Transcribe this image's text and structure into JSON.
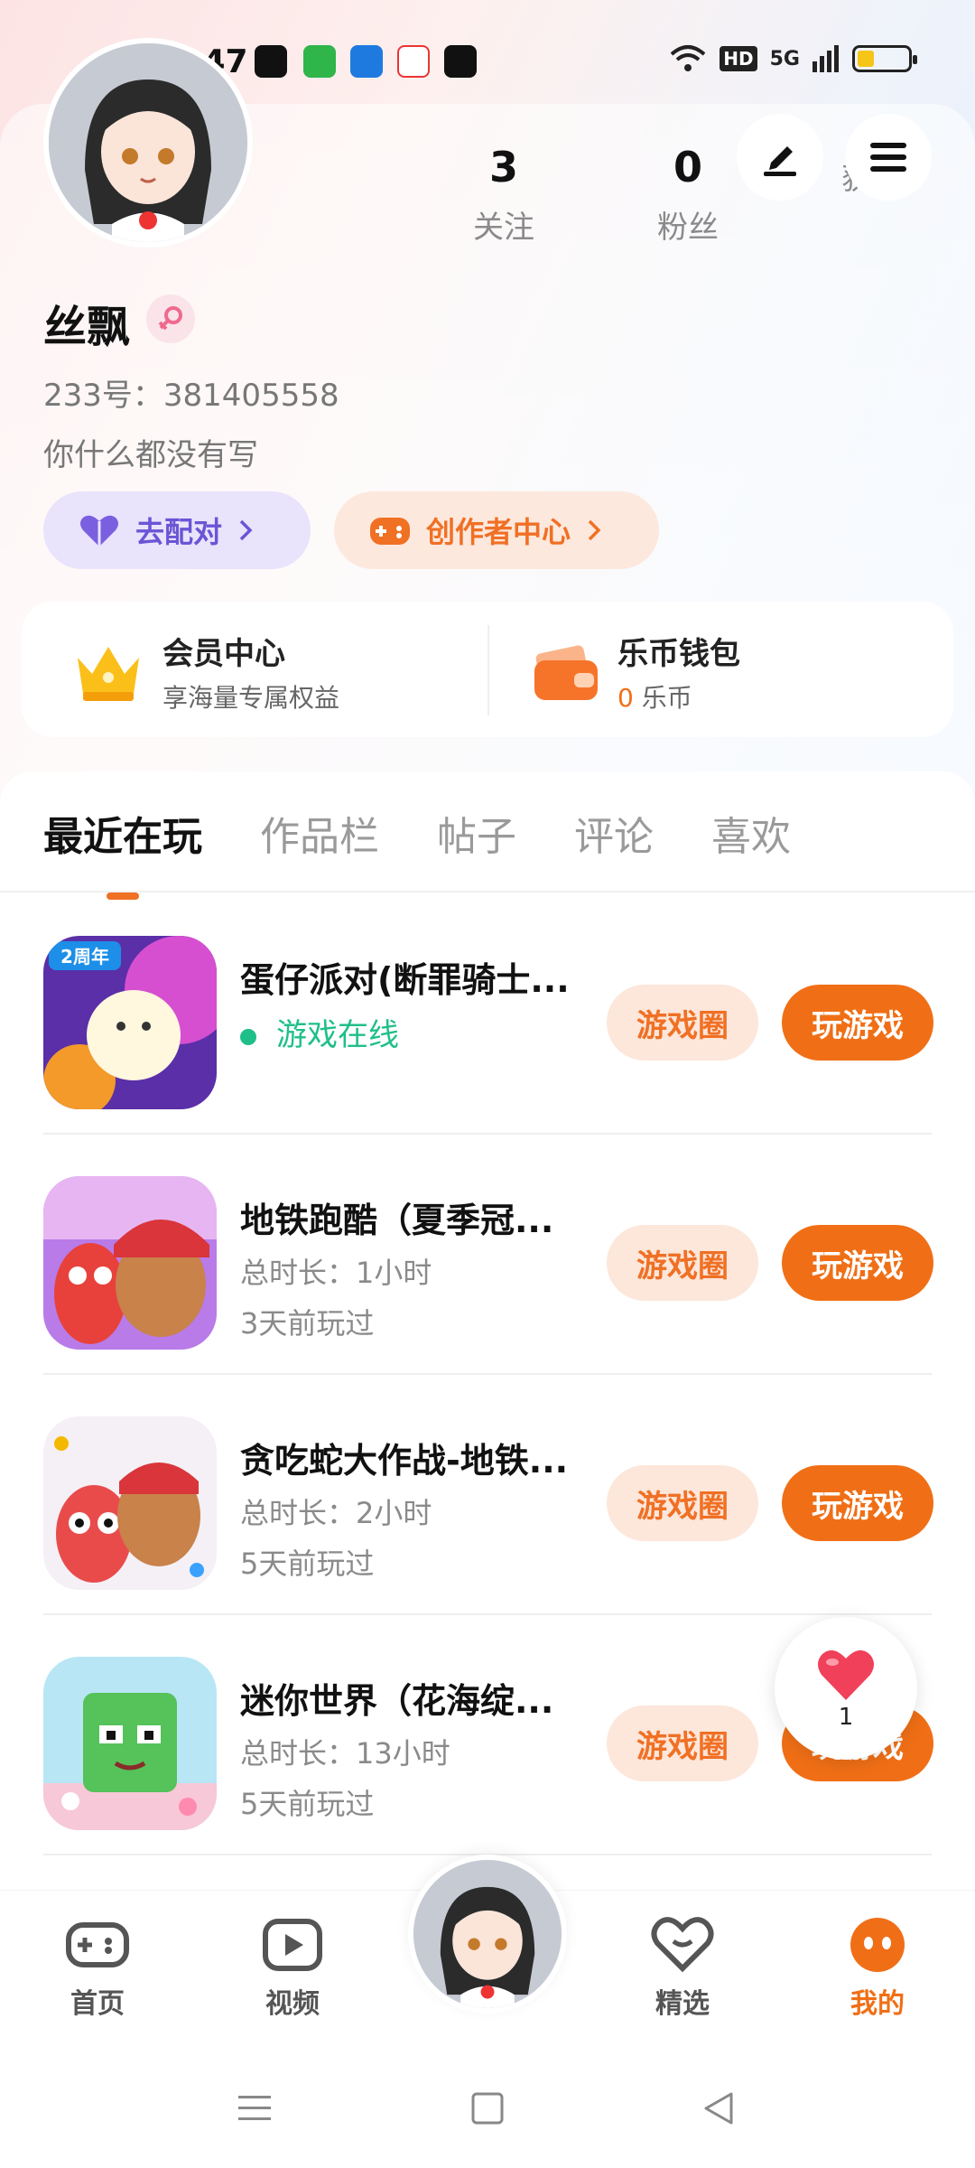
{
  "status_bar": {
    "time": "19:47",
    "network_label": "5G",
    "hd_label": "HD",
    "battery_level": 0.25,
    "notification_icons": [
      "tiktok-icon",
      "chat-icon",
      "feishu-icon",
      "video-icon",
      "app-icon"
    ]
  },
  "profile": {
    "name": "丝飘",
    "gender": "female",
    "uid_label": "233号：",
    "uid": "381405558",
    "bio": "你什么都没有写",
    "stats": [
      {
        "value": "3",
        "label": "关注"
      },
      {
        "value": "0",
        "label": "粉丝"
      },
      {
        "value": "",
        "label": "获赞"
      }
    ],
    "pills": {
      "match": "去配对",
      "creator": "创作者中心"
    }
  },
  "quick_links": {
    "vip": {
      "title": "会员中心",
      "subtitle": "享海量专属权益"
    },
    "wallet": {
      "title": "乐币钱包",
      "amount": "0",
      "unit": "乐币"
    }
  },
  "tabs": [
    "最近在玩",
    "作品栏",
    "帖子",
    "评论",
    "喜欢"
  ],
  "games": [
    {
      "title": "蛋仔派对(断罪骑士...",
      "line1": "游戏在线",
      "line2": "",
      "online": true,
      "circle_btn": "游戏圈",
      "play_btn": "玩游戏"
    },
    {
      "title": "地铁跑酷（夏季冠...",
      "line1": "总时长：1小时",
      "line2": "3天前玩过",
      "online": false,
      "circle_btn": "游戏圈",
      "play_btn": "玩游戏"
    },
    {
      "title": "贪吃蛇大作战-地铁...",
      "line1": "总时长：2小时",
      "line2": "5天前玩过",
      "online": false,
      "circle_btn": "游戏圈",
      "play_btn": "玩游戏"
    },
    {
      "title": "迷你世界（花海绽...",
      "line1": "总时长：13小时",
      "line2": "5天前玩过",
      "online": false,
      "circle_btn": "游戏圈",
      "play_btn": "玩游戏"
    }
  ],
  "game_icon_badge": "2周年",
  "floating_like": {
    "count": "1"
  },
  "bottom_nav": {
    "home": "首页",
    "video": "视频",
    "featured": "精选",
    "mine": "我的"
  },
  "colors": {
    "accent": "#f06f16",
    "accent_soft": "#fde6da",
    "match_purple": "#6a55d6",
    "online_green": "#1fbf8a"
  }
}
